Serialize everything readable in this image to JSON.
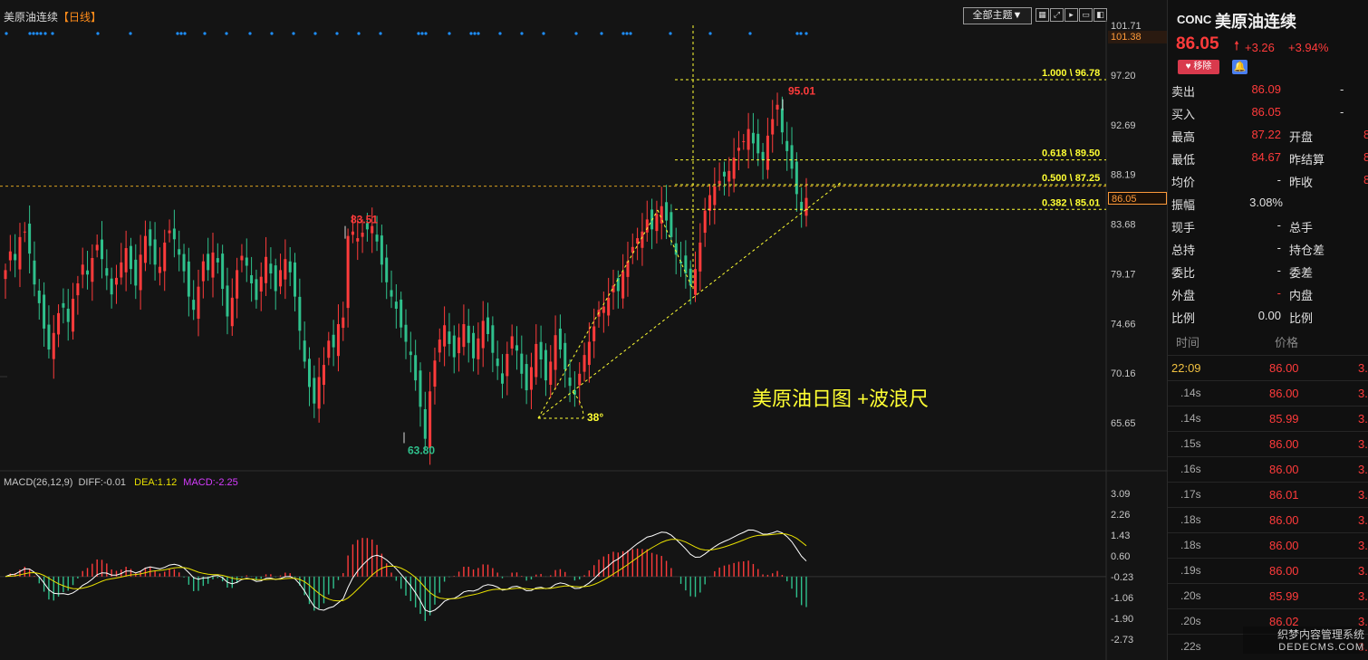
{
  "header": {
    "symbol_title": "美原油连续",
    "timeframe": "【日线】",
    "theme_button": "全部主题▼",
    "tool_icons": [
      "grid-icon",
      "expand-icon",
      "play-icon",
      "window-icon",
      "close-panel-icon"
    ]
  },
  "colors": {
    "up": "#ff3b3b",
    "down": "#2fc08c",
    "axis_text": "#c8c8c8",
    "fib": "#ffff33",
    "dash_orange": "#d9a020",
    "diff_line": "#ffffff",
    "dea_line": "#e8e000",
    "macd_purple": "#d63cff",
    "blue_marks": "#1e8fff"
  },
  "chart_data": [
    {
      "type": "candlestick",
      "title": "美原油日图 +波浪尺",
      "y_ticks": [
        101.71,
        97.2,
        92.69,
        88.19,
        83.68,
        79.17,
        74.66,
        70.16,
        65.65
      ],
      "ylim": [
        63.0,
        102.0
      ],
      "high_label": "101.38",
      "current_price": 86.05,
      "current_price_label": "86.05",
      "annotations": [
        {
          "text": "83.51",
          "value": 83.51,
          "kind": "high"
        },
        {
          "text": "63.80",
          "value": 63.8,
          "kind": "low"
        },
        {
          "text": "95.01",
          "value": 95.01,
          "kind": "high"
        },
        {
          "text": "38°",
          "kind": "angle"
        }
      ],
      "fibonacci": [
        {
          "label": "1.000 \\ 96.78",
          "value": 96.78
        },
        {
          "label": "0.618 \\ 89.50",
          "value": 89.5
        },
        {
          "label": "0.500 \\ 87.25",
          "value": 87.25
        },
        {
          "label": "0.382 \\ 85.01",
          "value": 85.01
        }
      ],
      "candles_approx_closes": [
        79.5,
        81.2,
        80.4,
        82.5,
        83.0,
        81.0,
        78.2,
        76.5,
        74.2,
        72.3,
        73.8,
        75.6,
        76.1,
        74.8,
        76.9,
        78.3,
        80.0,
        79.1,
        80.6,
        81.8,
        80.5,
        79.0,
        77.3,
        78.8,
        80.2,
        81.5,
        79.6,
        78.1,
        80.9,
        82.6,
        81.7,
        80.0,
        79.8,
        82.0,
        83.1,
        82.3,
        80.9,
        79.4,
        77.1,
        75.9,
        78.0,
        80.3,
        79.5,
        81.1,
        80.2,
        77.8,
        75.3,
        77.0,
        79.5,
        80.8,
        79.9,
        78.3,
        76.8,
        78.9,
        80.7,
        79.2,
        77.6,
        79.5,
        80.5,
        79.3,
        77.1,
        74.0,
        71.2,
        68.9,
        67.4,
        69.8,
        70.9,
        73.1,
        72.5,
        74.6,
        75.2,
        82.6,
        83.0,
        82.4,
        82.9,
        83.2,
        83.5,
        82.1,
        80.0,
        78.4,
        77.1,
        76.0,
        74.3,
        73.0,
        71.8,
        69.5,
        67.1,
        64.2,
        68.5,
        71.3,
        73.2,
        74.5,
        72.8,
        71.6,
        73.4,
        74.6,
        72.9,
        71.5,
        73.3,
        74.9,
        73.7,
        72.0,
        70.8,
        69.2,
        71.9,
        73.5,
        72.2,
        70.1,
        68.6,
        70.7,
        72.8,
        71.4,
        69.5,
        71.2,
        73.6,
        72.3,
        70.5,
        69.0,
        68.2,
        70.1,
        71.8,
        73.0,
        74.4,
        75.9,
        76.2,
        77.0,
        78.1,
        77.6,
        79.4,
        80.3,
        81.6,
        82.4,
        83.0,
        84.1,
        83.2,
        84.6,
        85.3,
        84.0,
        82.5,
        80.9,
        80.1,
        79.2,
        78.1,
        79.6,
        82.0,
        84.9,
        86.3,
        87.1,
        87.6,
        88.0,
        88.5,
        89.7,
        90.6,
        91.2,
        92.3,
        91.0,
        90.1,
        89.5,
        91.7,
        93.2,
        94.5,
        92.0,
        90.3,
        88.7,
        86.4,
        84.9,
        86.05
      ],
      "macd": {
        "label": "MACD(26,12,9)",
        "diff_text": "DIFF:-0.01",
        "dea_text": "DEA:1.12",
        "macd_text": "MACD:-2.25",
        "y_ticks": [
          3.09,
          2.26,
          1.43,
          0.6,
          -0.23,
          -1.06,
          -1.9,
          -2.73
        ],
        "ylim": [
          -3.0,
          3.3
        ]
      }
    }
  ],
  "quote": {
    "code": "CONC",
    "name": "美原油连续",
    "price": "86.05",
    "change": "+3.26",
    "change_pct": "+3.94%",
    "remove_button": "移除",
    "rows": [
      {
        "k1": "卖出",
        "v1": "86.09",
        "k2": "-",
        "v2": ""
      },
      {
        "k1": "买入",
        "v1": "86.05",
        "k2": "-",
        "v2": ""
      },
      {
        "k1": "最高",
        "v1": "87.22",
        "k2": "开盘",
        "v2": "8"
      },
      {
        "k1": "最低",
        "v1": "84.67",
        "k2": "昨结算",
        "v2": "8"
      },
      {
        "k1": "均价",
        "v1": "-",
        "k2": "昨收",
        "v2": "8"
      },
      {
        "k1": "振幅",
        "v1": "3.08%",
        "k2": "",
        "v2": ""
      },
      {
        "k1": "现手",
        "v1": "-",
        "k2": "总手",
        "v2": ""
      },
      {
        "k1": "总持",
        "v1": "-",
        "k2": "持仓差",
        "v2": ""
      },
      {
        "k1": "委比",
        "v1": "-",
        "k2": "委差",
        "v2": ""
      },
      {
        "k1": "外盘",
        "v1": "-",
        "k2": "内盘",
        "v2": ""
      },
      {
        "k1": "比例",
        "v1": "0.00",
        "k2": "比例",
        "v2": ""
      }
    ],
    "trades_header": {
      "time": "时间",
      "price": "价格"
    },
    "trades": [
      {
        "time": "22:09",
        "price": "86.00",
        "extra": "3."
      },
      {
        "time": ".14s",
        "price": "86.00",
        "extra": "3."
      },
      {
        "time": ".14s",
        "price": "85.99",
        "extra": "3."
      },
      {
        "time": ".15s",
        "price": "86.00",
        "extra": "3."
      },
      {
        "time": ".16s",
        "price": "86.00",
        "extra": "3."
      },
      {
        "time": ".17s",
        "price": "86.01",
        "extra": "3."
      },
      {
        "time": ".18s",
        "price": "86.00",
        "extra": "3."
      },
      {
        "time": ".18s",
        "price": "86.00",
        "extra": "3."
      },
      {
        "time": ".19s",
        "price": "86.00",
        "extra": "3."
      },
      {
        "time": ".20s",
        "price": "85.99",
        "extra": "3."
      },
      {
        "time": ".20s",
        "price": "86.02",
        "extra": "3."
      },
      {
        "time": ".22s",
        "price": "",
        "extra": "3."
      }
    ]
  },
  "watermark": {
    "line1": "织梦内容管理系统",
    "line2": "DEDECMS.COM"
  }
}
